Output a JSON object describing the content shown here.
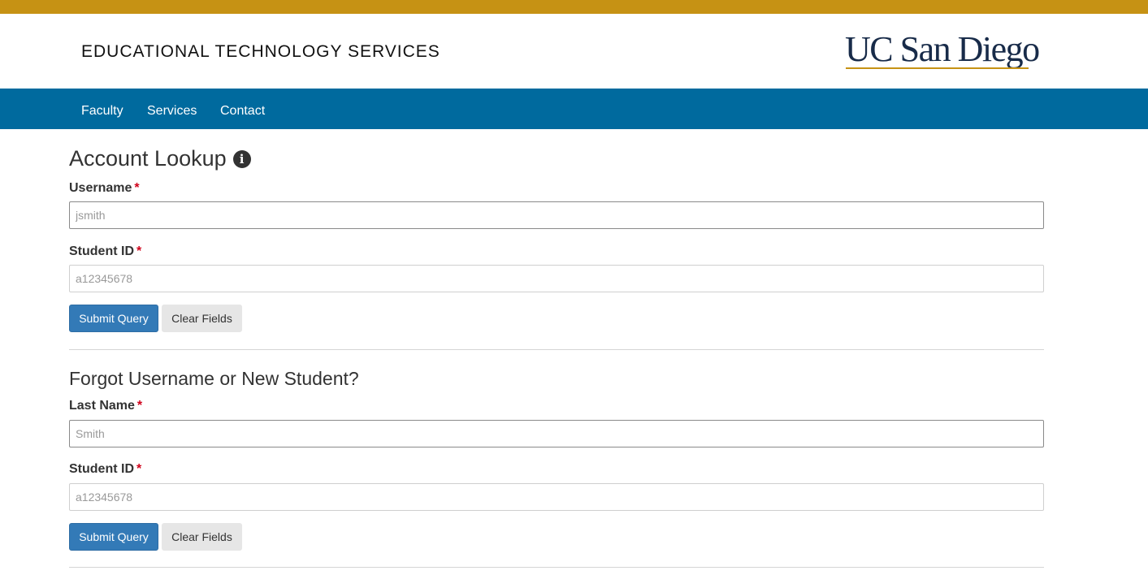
{
  "header": {
    "site_title": "EDUCATIONAL TECHNOLOGY SERVICES",
    "logo_text": "UC San Diego"
  },
  "nav": {
    "items": [
      {
        "label": "Faculty"
      },
      {
        "label": "Services"
      },
      {
        "label": "Contact"
      }
    ]
  },
  "account_lookup": {
    "title": "Account Lookup",
    "info_icon": "info-circle-icon",
    "username_label": "Username",
    "username_placeholder": "jsmith",
    "student_id_label": "Student ID",
    "student_id_placeholder": "a12345678",
    "submit_label": "Submit Query",
    "clear_label": "Clear Fields"
  },
  "forgot": {
    "title": "Forgot Username or New Student?",
    "last_name_label": "Last Name",
    "last_name_placeholder": "Smith",
    "student_id_label": "Student ID",
    "student_id_placeholder": "a12345678",
    "submit_label": "Submit Query",
    "clear_label": "Clear Fields"
  },
  "required_marker": "*",
  "colors": {
    "gold": "#c69214",
    "nav_blue": "#006a9e",
    "navy": "#182b49",
    "button_primary": "#337ab7",
    "required": "#d0021b"
  }
}
